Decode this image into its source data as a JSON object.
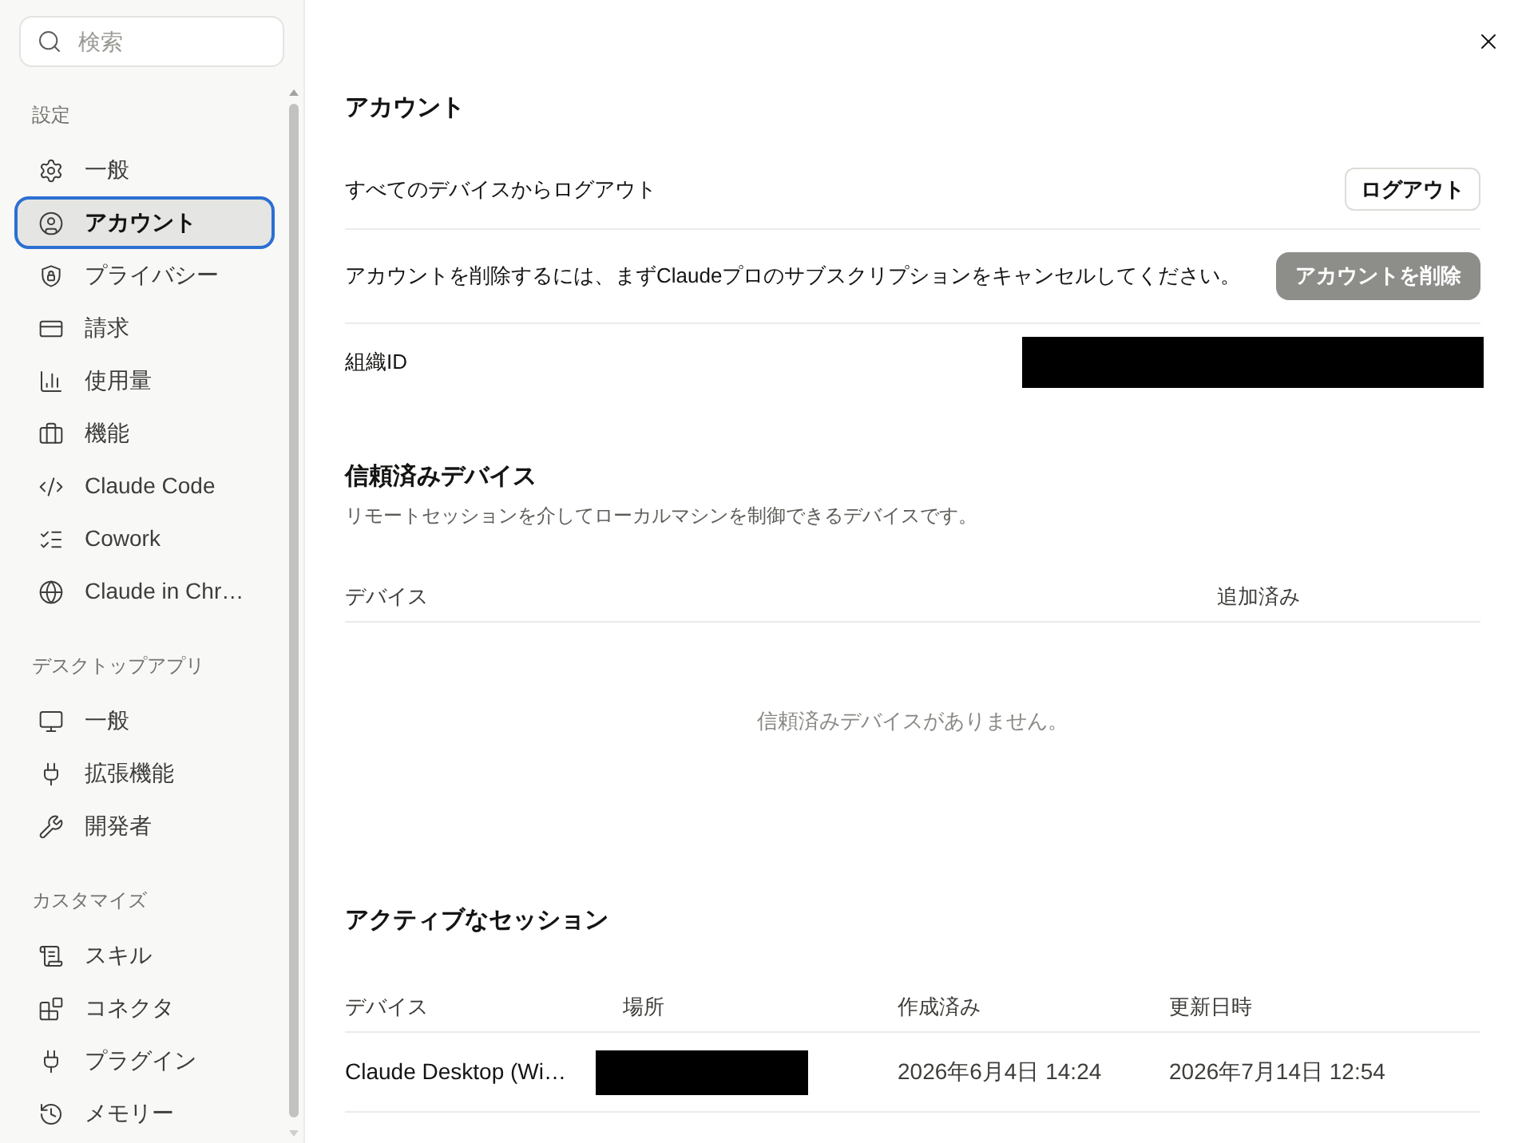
{
  "sidebar": {
    "search": {
      "placeholder": "検索"
    },
    "sections": [
      {
        "label": "設定",
        "items": [
          {
            "label": "一般",
            "selected": false
          },
          {
            "label": "アカウント",
            "selected": true
          },
          {
            "label": "プライバシー",
            "selected": false
          },
          {
            "label": "請求",
            "selected": false
          },
          {
            "label": "使用量",
            "selected": false
          },
          {
            "label": "機能",
            "selected": false
          },
          {
            "label": "Claude Code",
            "selected": false
          },
          {
            "label": "Cowork",
            "selected": false
          },
          {
            "label": "Claude in Chr…",
            "selected": false
          }
        ]
      },
      {
        "label": "デスクトップアプリ",
        "items": [
          {
            "label": "一般",
            "selected": false
          },
          {
            "label": "拡張機能",
            "selected": false
          },
          {
            "label": "開発者",
            "selected": false
          }
        ]
      },
      {
        "label": "カスタマイズ",
        "items": [
          {
            "label": "スキル",
            "selected": false
          },
          {
            "label": "コネクタ",
            "selected": false
          },
          {
            "label": "プラグイン",
            "selected": false
          },
          {
            "label": "メモリー",
            "selected": false
          }
        ]
      }
    ]
  },
  "account": {
    "title": "アカウント",
    "rows": [
      {
        "kind": "action",
        "label": "すべてのデバイスからログアウト",
        "button": {
          "label": "ログアウト",
          "disabled": false
        }
      },
      {
        "kind": "action",
        "label": "アカウントを削除するには、まずClaudeプロのサブスクリプションをキャンセルしてください。",
        "button": {
          "label": "アカウントを削除",
          "disabled": true
        }
      },
      {
        "kind": "redacted",
        "label": "組織ID"
      }
    ]
  },
  "trusted_devices": {
    "title": "信頼済みデバイス",
    "description": "リモートセッションを介してローカルマシンを制御できるデバイスです。",
    "columns": [
      "デバイス",
      "追加済み"
    ],
    "empty_message": "信頼済みデバイスがありません。"
  },
  "active_sessions": {
    "title": "アクティブなセッション",
    "columns": [
      "デバイス",
      "場所",
      "作成済み",
      "更新日時"
    ],
    "rows": [
      {
        "device": "Claude Desktop (Wi…",
        "location_redacted": true,
        "created": "2026年6月4日 14:24",
        "updated": "2026年7月14日 12:54"
      }
    ]
  }
}
